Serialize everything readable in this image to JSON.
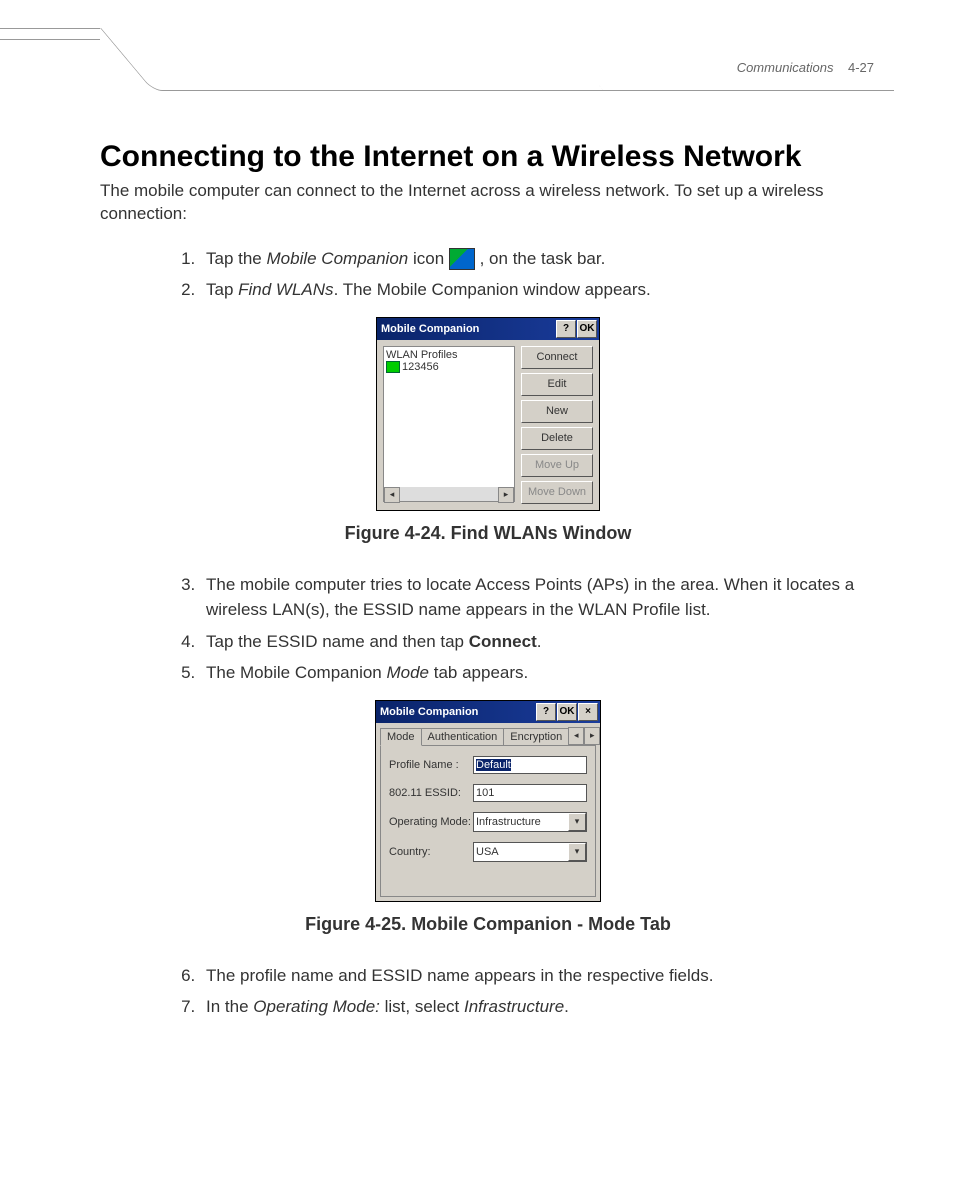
{
  "header": {
    "section": "Communications",
    "page": "4-27"
  },
  "title": "Connecting to the Internet on a Wireless Network",
  "intro": "The mobile computer can connect to the Internet across a wireless network. To set up a wireless connection:",
  "steps": {
    "s1a": "Tap the ",
    "s1b": "Mobile Companion",
    "s1c": " icon ",
    "s1d": " , on the task bar.",
    "s2a": "Tap ",
    "s2b": "Find WLANs",
    "s2c": ". The Mobile Companion window appears.",
    "s3": "The mobile computer tries to locate Access Points (APs) in the area. When it locates a wireless LAN(s), the ESSID name appears in the WLAN Profile list.",
    "s4a": "Tap the ESSID name and then tap ",
    "s4b": "Connect",
    "s4c": ".",
    "s5a": "The Mobile Companion ",
    "s5b": "Mode",
    "s5c": " tab appears.",
    "s6": "The profile name and ESSID name appears in the respective fields.",
    "s7a": "In the ",
    "s7b": "Operating Mode:",
    "s7c": " list, select ",
    "s7d": "Infrastructure",
    "s7e": "."
  },
  "fig1_caption": "Figure 4-24.  Find WLANs Window",
  "fig2_caption": "Figure 4-25.  Mobile Companion - Mode Tab",
  "win1": {
    "title": "Mobile Companion",
    "help": "?",
    "ok": "OK",
    "profiles_hdr": "WLAN Profiles",
    "profile_item": "123456",
    "buttons": {
      "connect": "Connect",
      "edit": "Edit",
      "new": "New",
      "delete": "Delete",
      "moveup": "Move Up",
      "movedown": "Move Down"
    }
  },
  "win2": {
    "title": "Mobile Companion",
    "help": "?",
    "ok": "OK",
    "close": "×",
    "tabs": {
      "mode": "Mode",
      "auth": "Authentication",
      "enc": "Encryption"
    },
    "fields": {
      "profile_label": "Profile Name :",
      "profile_value": "Default",
      "essid_label": "802.11 ESSID:",
      "essid_value": "101",
      "opmode_label": "Operating Mode:",
      "opmode_value": "Infrastructure",
      "country_label": "Country:",
      "country_value": "USA"
    }
  }
}
